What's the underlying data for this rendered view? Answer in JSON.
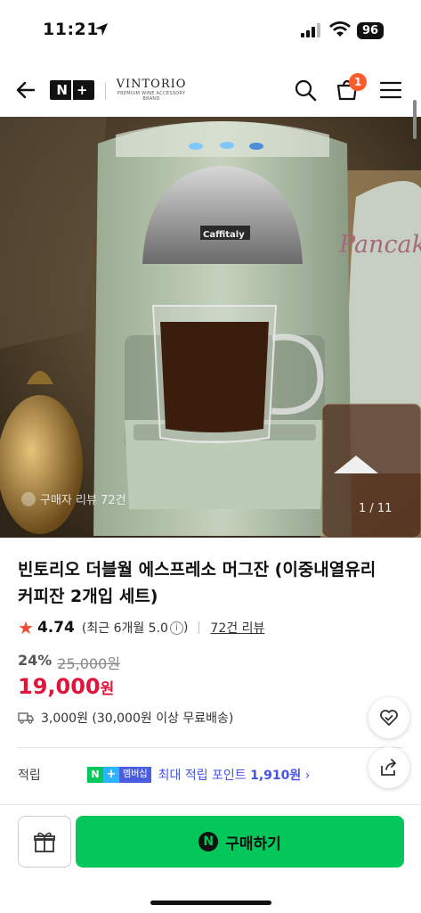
{
  "status": {
    "time": "11:21",
    "battery": "96"
  },
  "nav": {
    "back_icon": "arrow-left-icon",
    "brand_mark": "N+",
    "brand_name": "VINTORIO",
    "brand_tagline": "PREMIUM WINE ACCESSORY BRAND",
    "cart_count": "1",
    "accent": "#ff5a2a"
  },
  "hero": {
    "overlay_text": "Pancake",
    "review_badge": "구매자 리뷰 72건",
    "counter": "1 / 11",
    "machine_label": "Caffitaly"
  },
  "product": {
    "title": "빈토리오 더블월 에스프레소 머그잔 (이중내열유리 커피잔 2개입 세트)",
    "rating": "4.74",
    "rating_recent": "(최근 6개월 5.0",
    "rating_info": "i",
    "rating_close": ")",
    "review_link": "72건 리뷰",
    "discount_pct": "24%",
    "original_price": "25,000원",
    "price": "19,000",
    "price_unit": "원",
    "shipping": "3,000원 (30,000원 이상 무료배송)",
    "price_color": "#e2143b"
  },
  "points": {
    "label": "적립",
    "membership_n": "N",
    "membership_plus": "+",
    "membership_label": "멤버십",
    "text_prefix": "최대 적립 포인트",
    "text_value": "1,910원",
    "color": "#4654e8"
  },
  "bottom": {
    "buy_icon": "N",
    "buy_label": "구매하기",
    "buy_color": "#03c75a"
  }
}
